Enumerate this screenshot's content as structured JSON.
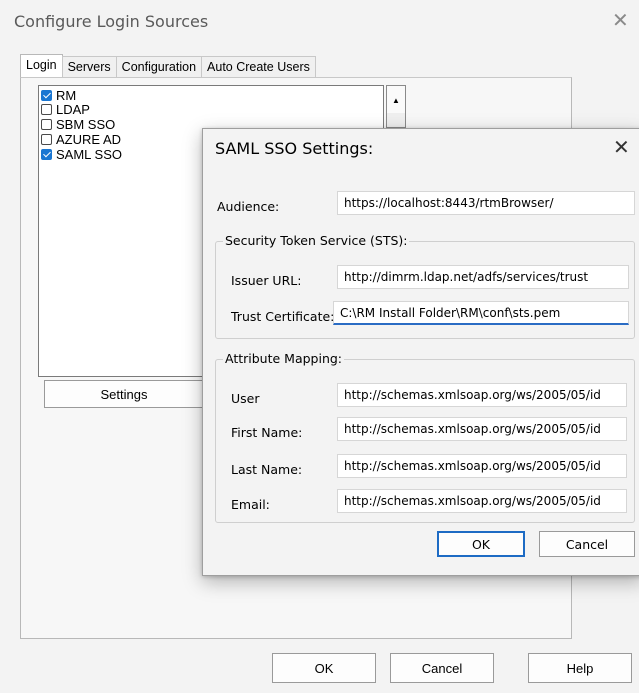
{
  "window": {
    "title": "Configure Login Sources",
    "close_glyph": "✕"
  },
  "tabs": [
    {
      "label": "Login",
      "active": true
    },
    {
      "label": "Servers",
      "active": false
    },
    {
      "label": "Configuration",
      "active": false
    },
    {
      "label": "Auto Create Users",
      "active": false
    }
  ],
  "login_sources": [
    {
      "label": "RM",
      "checked": true
    },
    {
      "label": "LDAP",
      "checked": false
    },
    {
      "label": "SBM SSO",
      "checked": false
    },
    {
      "label": "AZURE AD",
      "checked": false
    },
    {
      "label": "SAML SSO",
      "checked": true
    }
  ],
  "settings_label": "Settings",
  "bottom_buttons": {
    "ok": "OK",
    "cancel": "Cancel",
    "help": "Help"
  },
  "saml_dialog": {
    "title": "SAML SSO Settings:",
    "close_glyph": "✕",
    "audience_label": "Audience:",
    "audience_value": "https://localhost:8443/rtmBrowser/",
    "sts_group": "Security Token Service (STS):",
    "issuer_label": "Issuer URL:",
    "issuer_value": "http://dimrm.ldap.net/adfs/services/trust",
    "cert_label": "Trust Certificate:",
    "cert_value": "C:\\RM Install Folder\\RM\\conf\\sts.pem",
    "mapping_group": "Attribute Mapping:",
    "mapping": [
      {
        "label": "User",
        "value": "http://schemas.xmlsoap.org/ws/2005/05/id"
      },
      {
        "label": "First Name:",
        "value": "http://schemas.xmlsoap.org/ws/2005/05/id"
      },
      {
        "label": "Last Name:",
        "value": "http://schemas.xmlsoap.org/ws/2005/05/id"
      },
      {
        "label": "Email:",
        "value": "http://schemas.xmlsoap.org/ws/2005/05/id"
      }
    ],
    "ok": "OK",
    "cancel": "Cancel"
  },
  "icons": {
    "close": "close-icon",
    "scroll_up": "scroll-up-arrow-icon",
    "checkbox": "checkbox-icon"
  },
  "colors": {
    "accent": "#1976d2",
    "focus": "#2a6cc4"
  }
}
